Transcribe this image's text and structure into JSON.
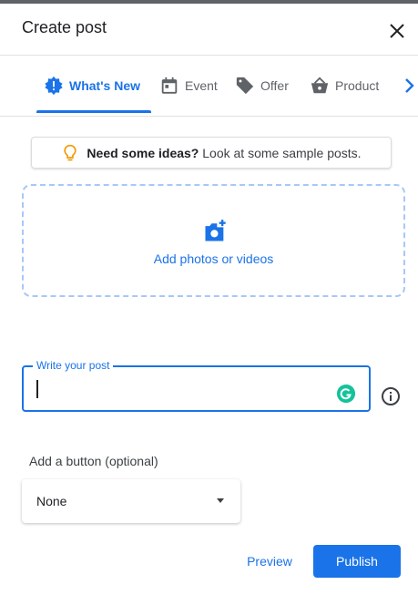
{
  "dialog": {
    "title": "Create post"
  },
  "tabs": [
    {
      "label": "What's New",
      "icon": "alert-badge-icon",
      "active": true
    },
    {
      "label": "Event",
      "icon": "calendar-icon",
      "active": false
    },
    {
      "label": "Offer",
      "icon": "tag-icon",
      "active": false
    },
    {
      "label": "Product",
      "icon": "shopping-basket-icon",
      "active": false
    }
  ],
  "ideas": {
    "bold": "Need some ideas?",
    "rest": "Look at some sample posts."
  },
  "upload": {
    "label": "Add photos or videos"
  },
  "post": {
    "label": "Write your post",
    "value": ""
  },
  "button_section": {
    "label": "Add a button (optional)",
    "selected": "None"
  },
  "actions": {
    "preview": "Preview",
    "publish": "Publish"
  },
  "colors": {
    "accent": "#1a73e8",
    "grammarly": "#15c39a",
    "bulb": "#f29900"
  }
}
